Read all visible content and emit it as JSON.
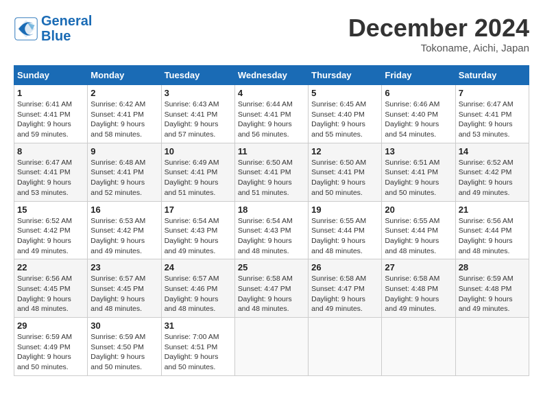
{
  "header": {
    "logo_line1": "General",
    "logo_line2": "Blue",
    "month": "December 2024",
    "location": "Tokoname, Aichi, Japan"
  },
  "weekdays": [
    "Sunday",
    "Monday",
    "Tuesday",
    "Wednesday",
    "Thursday",
    "Friday",
    "Saturday"
  ],
  "weeks": [
    [
      {
        "day": "1",
        "sunrise": "6:41 AM",
        "sunset": "4:41 PM",
        "daylight": "9 hours and 59 minutes."
      },
      {
        "day": "2",
        "sunrise": "6:42 AM",
        "sunset": "4:41 PM",
        "daylight": "9 hours and 58 minutes."
      },
      {
        "day": "3",
        "sunrise": "6:43 AM",
        "sunset": "4:41 PM",
        "daylight": "9 hours and 57 minutes."
      },
      {
        "day": "4",
        "sunrise": "6:44 AM",
        "sunset": "4:41 PM",
        "daylight": "9 hours and 56 minutes."
      },
      {
        "day": "5",
        "sunrise": "6:45 AM",
        "sunset": "4:40 PM",
        "daylight": "9 hours and 55 minutes."
      },
      {
        "day": "6",
        "sunrise": "6:46 AM",
        "sunset": "4:40 PM",
        "daylight": "9 hours and 54 minutes."
      },
      {
        "day": "7",
        "sunrise": "6:47 AM",
        "sunset": "4:41 PM",
        "daylight": "9 hours and 53 minutes."
      }
    ],
    [
      {
        "day": "8",
        "sunrise": "6:47 AM",
        "sunset": "4:41 PM",
        "daylight": "9 hours and 53 minutes."
      },
      {
        "day": "9",
        "sunrise": "6:48 AM",
        "sunset": "4:41 PM",
        "daylight": "9 hours and 52 minutes."
      },
      {
        "day": "10",
        "sunrise": "6:49 AM",
        "sunset": "4:41 PM",
        "daylight": "9 hours and 51 minutes."
      },
      {
        "day": "11",
        "sunrise": "6:50 AM",
        "sunset": "4:41 PM",
        "daylight": "9 hours and 51 minutes."
      },
      {
        "day": "12",
        "sunrise": "6:50 AM",
        "sunset": "4:41 PM",
        "daylight": "9 hours and 50 minutes."
      },
      {
        "day": "13",
        "sunrise": "6:51 AM",
        "sunset": "4:41 PM",
        "daylight": "9 hours and 50 minutes."
      },
      {
        "day": "14",
        "sunrise": "6:52 AM",
        "sunset": "4:42 PM",
        "daylight": "9 hours and 49 minutes."
      }
    ],
    [
      {
        "day": "15",
        "sunrise": "6:52 AM",
        "sunset": "4:42 PM",
        "daylight": "9 hours and 49 minutes."
      },
      {
        "day": "16",
        "sunrise": "6:53 AM",
        "sunset": "4:42 PM",
        "daylight": "9 hours and 49 minutes."
      },
      {
        "day": "17",
        "sunrise": "6:54 AM",
        "sunset": "4:43 PM",
        "daylight": "9 hours and 49 minutes."
      },
      {
        "day": "18",
        "sunrise": "6:54 AM",
        "sunset": "4:43 PM",
        "daylight": "9 hours and 48 minutes."
      },
      {
        "day": "19",
        "sunrise": "6:55 AM",
        "sunset": "4:44 PM",
        "daylight": "9 hours and 48 minutes."
      },
      {
        "day": "20",
        "sunrise": "6:55 AM",
        "sunset": "4:44 PM",
        "daylight": "9 hours and 48 minutes."
      },
      {
        "day": "21",
        "sunrise": "6:56 AM",
        "sunset": "4:44 PM",
        "daylight": "9 hours and 48 minutes."
      }
    ],
    [
      {
        "day": "22",
        "sunrise": "6:56 AM",
        "sunset": "4:45 PM",
        "daylight": "9 hours and 48 minutes."
      },
      {
        "day": "23",
        "sunrise": "6:57 AM",
        "sunset": "4:45 PM",
        "daylight": "9 hours and 48 minutes."
      },
      {
        "day": "24",
        "sunrise": "6:57 AM",
        "sunset": "4:46 PM",
        "daylight": "9 hours and 48 minutes."
      },
      {
        "day": "25",
        "sunrise": "6:58 AM",
        "sunset": "4:47 PM",
        "daylight": "9 hours and 48 minutes."
      },
      {
        "day": "26",
        "sunrise": "6:58 AM",
        "sunset": "4:47 PM",
        "daylight": "9 hours and 49 minutes."
      },
      {
        "day": "27",
        "sunrise": "6:58 AM",
        "sunset": "4:48 PM",
        "daylight": "9 hours and 49 minutes."
      },
      {
        "day": "28",
        "sunrise": "6:59 AM",
        "sunset": "4:48 PM",
        "daylight": "9 hours and 49 minutes."
      }
    ],
    [
      {
        "day": "29",
        "sunrise": "6:59 AM",
        "sunset": "4:49 PM",
        "daylight": "9 hours and 50 minutes."
      },
      {
        "day": "30",
        "sunrise": "6:59 AM",
        "sunset": "4:50 PM",
        "daylight": "9 hours and 50 minutes."
      },
      {
        "day": "31",
        "sunrise": "7:00 AM",
        "sunset": "4:51 PM",
        "daylight": "9 hours and 50 minutes."
      },
      null,
      null,
      null,
      null
    ]
  ]
}
